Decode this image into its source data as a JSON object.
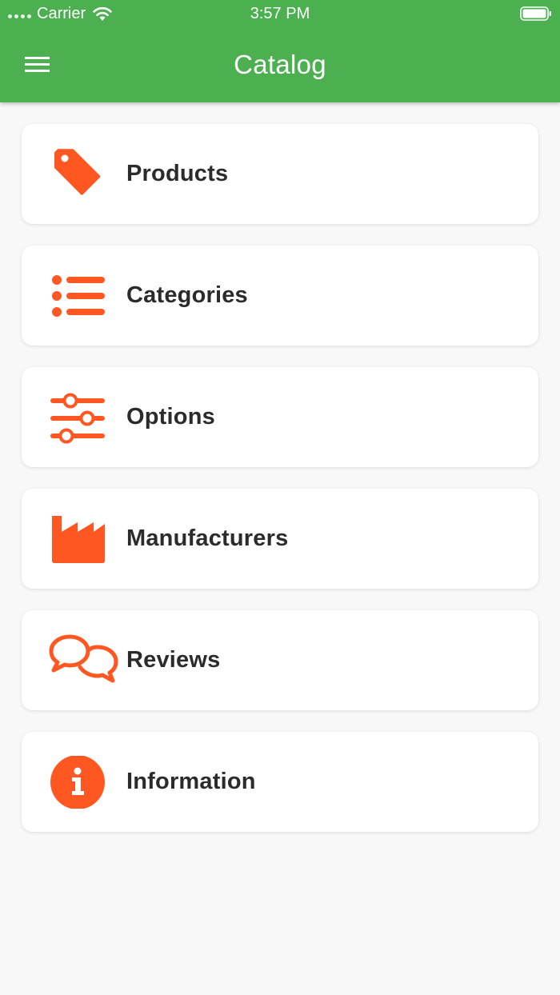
{
  "status_bar": {
    "carrier": "Carrier",
    "time": "3:57 PM"
  },
  "header": {
    "title": "Catalog",
    "menu_icon": "hamburger-menu-icon",
    "background_color": "#4caf50"
  },
  "menu": {
    "accent_color": "#ff5722",
    "items": [
      {
        "label": "Products",
        "icon": "tag-icon"
      },
      {
        "label": "Categories",
        "icon": "list-icon"
      },
      {
        "label": "Options",
        "icon": "sliders-icon"
      },
      {
        "label": "Manufacturers",
        "icon": "factory-icon"
      },
      {
        "label": "Reviews",
        "icon": "chat-bubbles-icon"
      },
      {
        "label": "Information",
        "icon": "info-circle-icon"
      }
    ]
  }
}
